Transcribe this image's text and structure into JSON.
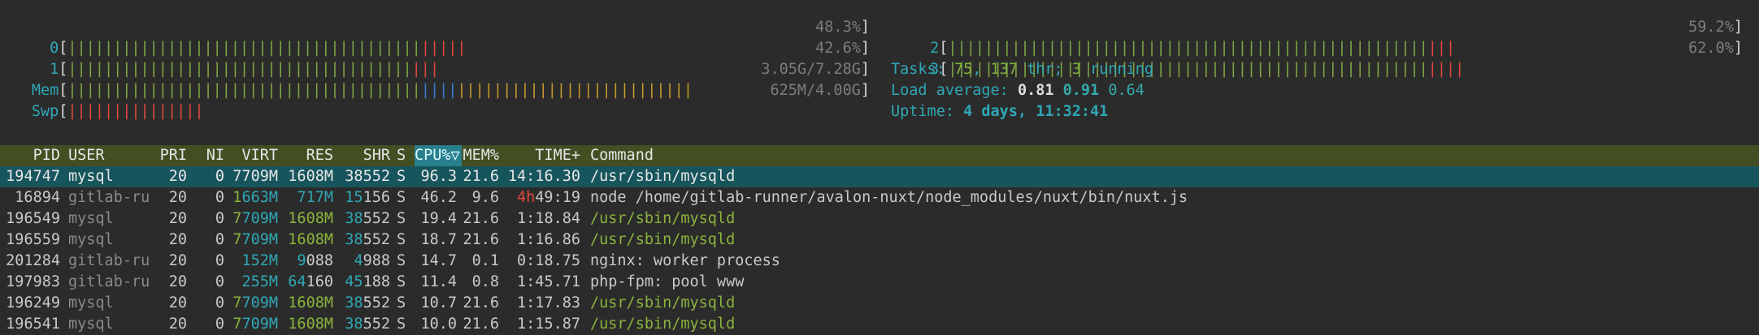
{
  "meters": {
    "cpu0": {
      "label": "0",
      "green": "|||||||||||||||||||||||||||||||||||||||",
      "red": "|||||",
      "value": "48.3%"
    },
    "cpu1": {
      "label": "1",
      "green": "||||||||||||||||||||||||||||||||||||||",
      "red": "|||",
      "value": "42.6%"
    },
    "mem": {
      "label": "Mem",
      "green": "|||||||||||||||||||||||||||||||||||||||",
      "blue": "||||",
      "yellow": "||||||||||||||||||||||||||",
      "value": "3.05G/7.28G"
    },
    "swp": {
      "label": "Swp",
      "red": "|||||||||||||||",
      "value": "625M/4.00G"
    },
    "cpu2": {
      "label": "2",
      "green": "|||||||||||||||||||||||||||||||||||||||||||||||||||||",
      "red": "|||",
      "value": "59.2%"
    },
    "cpu3": {
      "label": "3",
      "green": "|||||||||||||||||||||||||||||||||||||||||||||||||||||",
      "red": "||||",
      "value": "62.0%"
    }
  },
  "info": {
    "tasks_label": "Tasks: ",
    "tasks": "75",
    "sep": ", ",
    "threads": "137",
    "threads_label": " thr; ",
    "running": "3",
    "running_label": " running",
    "load_label": "Load average: ",
    "load1": "0.81",
    "load5": "0.91",
    "load15": "0.64",
    "uptime_label": "Uptime: ",
    "uptime": "4 days, 11:32:41"
  },
  "columns": {
    "pid": "PID",
    "user": "USER",
    "pri": "PRI",
    "ni": "NI",
    "virt": "VIRT",
    "res": "RES",
    "shr": "SHR",
    "s": "S",
    "cpu": "CPU%▽",
    "mem": "MEM%",
    "time": "TIME+",
    "cmd": "Command"
  },
  "processes": [
    {
      "pid": "194747",
      "user": "mysql",
      "pri": "20",
      "ni": "0",
      "virt": "7709M",
      "res": "1608M",
      "shr": "38552",
      "s": "S",
      "cpu": "96.3",
      "mem": "21.6",
      "time": "14:16.30",
      "cmd": "/usr/sbin/mysqld"
    },
    {
      "pid": "16894",
      "user": "gitlab-ru",
      "pri": "20",
      "ni": "0",
      "virt": "1663M",
      "res": "717M",
      "shr": "15156",
      "s": "S",
      "cpu": "46.2",
      "mem": "9.6",
      "time_hl": "4h",
      "time": "49:19",
      "cmd": "node /home/gitlab-runner/avalon-nuxt/node_modules/nuxt/bin/nuxt.js"
    },
    {
      "pid": "196549",
      "user": "mysql",
      "pri": "20",
      "ni": "0",
      "virt": "7709M",
      "res": "1608M",
      "shr": "38552",
      "s": "S",
      "cpu": "19.4",
      "mem": "21.6",
      "time": "1:18.84",
      "cmd": "/usr/sbin/mysqld"
    },
    {
      "pid": "196559",
      "user": "mysql",
      "pri": "20",
      "ni": "0",
      "virt": "7709M",
      "res": "1608M",
      "shr": "38552",
      "s": "S",
      "cpu": "18.7",
      "mem": "21.6",
      "time": "1:16.86",
      "cmd": "/usr/sbin/mysqld"
    },
    {
      "pid": "201284",
      "user": "gitlab-ru",
      "pri": "20",
      "ni": "0",
      "virt": "152M",
      "res": "9088",
      "shr": "4988",
      "s": "S",
      "cpu": "14.7",
      "mem": "0.1",
      "time": "0:18.75",
      "cmd": "nginx: worker process"
    },
    {
      "pid": "197983",
      "user": "gitlab-ru",
      "pri": "20",
      "ni": "0",
      "virt": "255M",
      "res": "64160",
      "shr": "45188",
      "s": "S",
      "cpu": "11.4",
      "mem": "0.8",
      "time": "1:45.71",
      "cmd": "php-fpm: pool www"
    },
    {
      "pid": "196249",
      "user": "mysql",
      "pri": "20",
      "ni": "0",
      "virt": "7709M",
      "res": "1608M",
      "shr": "38552",
      "s": "S",
      "cpu": "10.7",
      "mem": "21.6",
      "time": "1:17.83",
      "cmd": "/usr/sbin/mysqld"
    },
    {
      "pid": "196541",
      "user": "mysql",
      "pri": "20",
      "ni": "0",
      "virt": "7709M",
      "res": "1608M",
      "shr": "38552",
      "s": "S",
      "cpu": "10.0",
      "mem": "21.6",
      "time": "1:15.87",
      "cmd": "/usr/sbin/mysqld"
    }
  ]
}
